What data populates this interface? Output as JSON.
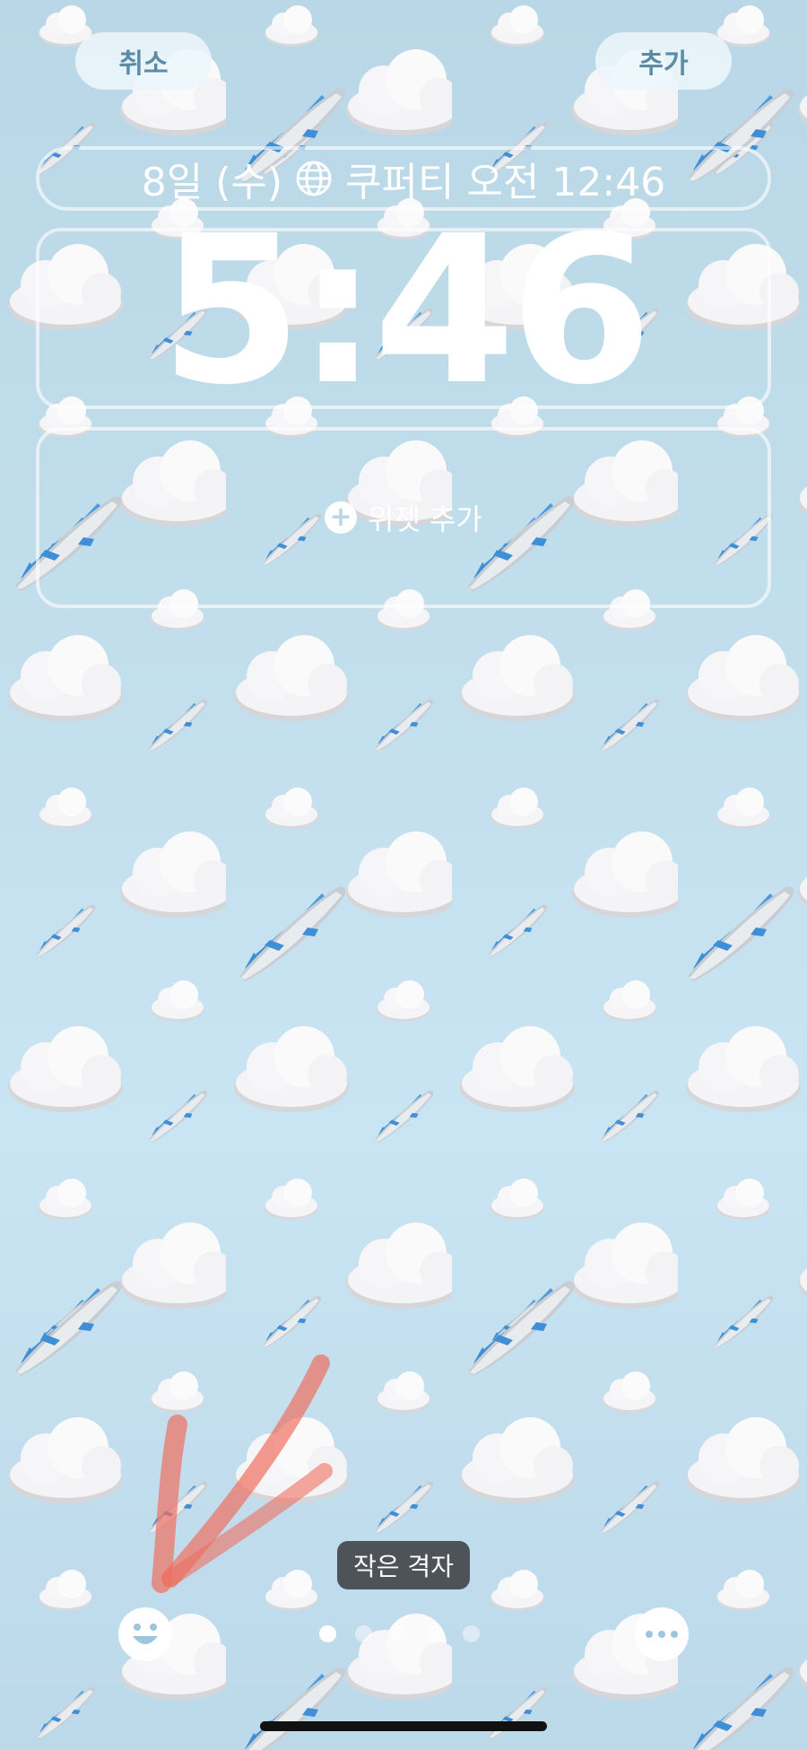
{
  "top_bar": {
    "cancel_label": "취소",
    "add_label": "추가"
  },
  "lock_screen": {
    "date_text": "8일 (수)",
    "world_clock_text": "쿠퍼티 오전 12:46",
    "time": "5:46",
    "add_widget_label": "위젯 추가"
  },
  "style_badge": {
    "label": "작은 격자"
  },
  "bottom_bar": {
    "left_icon": "smiley-emoji-icon",
    "right_icon": "more-ellipsis-icon",
    "page_count": 5,
    "active_page": 1
  },
  "wallpaper": {
    "pattern": "airplane-and-cloud-emoji-grid",
    "background_color": "#c4e0ee"
  },
  "colors": {
    "button_text": "#5b8ca5",
    "badge_bg": "#3c4044",
    "annotation_stroke": "#ef6f5f"
  }
}
